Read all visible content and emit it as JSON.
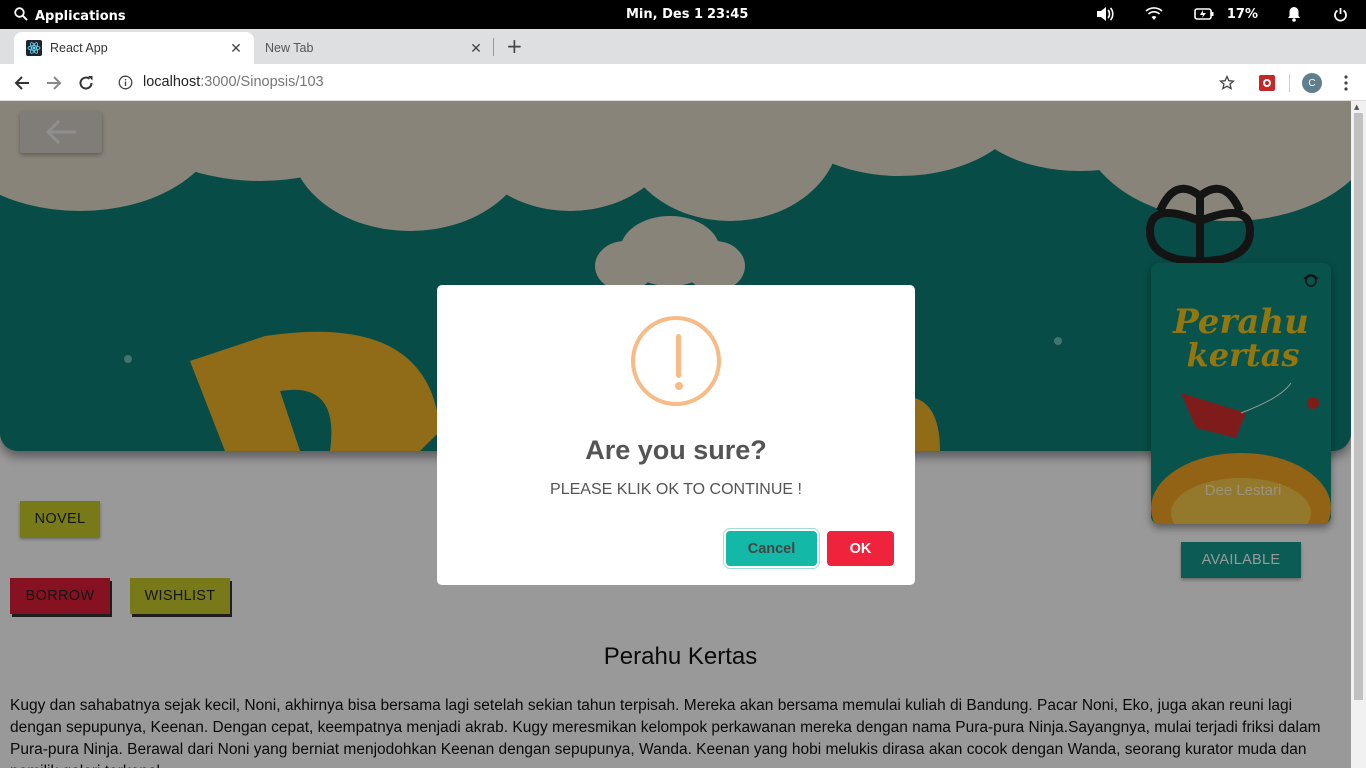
{
  "system_bar": {
    "applications": "Applications",
    "date": "Min, Des  1",
    "time": "23:45",
    "battery_percent": "17%"
  },
  "browser": {
    "tabs": [
      {
        "title": "React App",
        "active": true
      },
      {
        "title": "New Tab",
        "active": false
      }
    ],
    "url_host": "localhost",
    "url_path": ":3000/Sinopsis/103",
    "profile_initial": "C"
  },
  "page": {
    "cover": {
      "title_line1": "Perahu",
      "title_line2": "kertas",
      "author": "Dee Lestari"
    },
    "banner_letter": "D",
    "buttons": {
      "novel": "NOVEL",
      "borrow": "BORROW",
      "wishlist": "WISHLIST",
      "available": "AVAILABLE"
    },
    "book_title": "Perahu Kertas",
    "synopsis": "Kugy dan sahabatnya sejak kecil, Noni, akhirnya bisa bersama lagi setelah sekian tahun terpisah. Mereka akan bersama memulai kuliah di Bandung. Pacar Noni, Eko, juga akan reuni lagi dengan sepupunya, Keenan. Dengan cepat, keempatnya menjadi akrab. Kugy meresmikan kelompok perkawanan mereka dengan nama Pura-pura Ninja.Sayangnya, mulai terjadi friksi dalam Pura-pura Ninja. Berawal dari Noni yang berniat menjodohkan Keenan dengan sepupunya, Wanda. Keenan yang hobi melukis dirasa akan cocok dengan Wanda, seorang kurator muda dan pemilik galeri terkenal,"
  },
  "dialog": {
    "title": "Are you sure?",
    "text": "PLEASE KLIK OK TO CONTINUE !",
    "cancel_label": "Cancel",
    "ok_label": "OK",
    "icon_color": "#f8bb86"
  },
  "colors": {
    "teal": "#11998e",
    "red": "#e01e37",
    "yellow": "#c9cc2c"
  }
}
